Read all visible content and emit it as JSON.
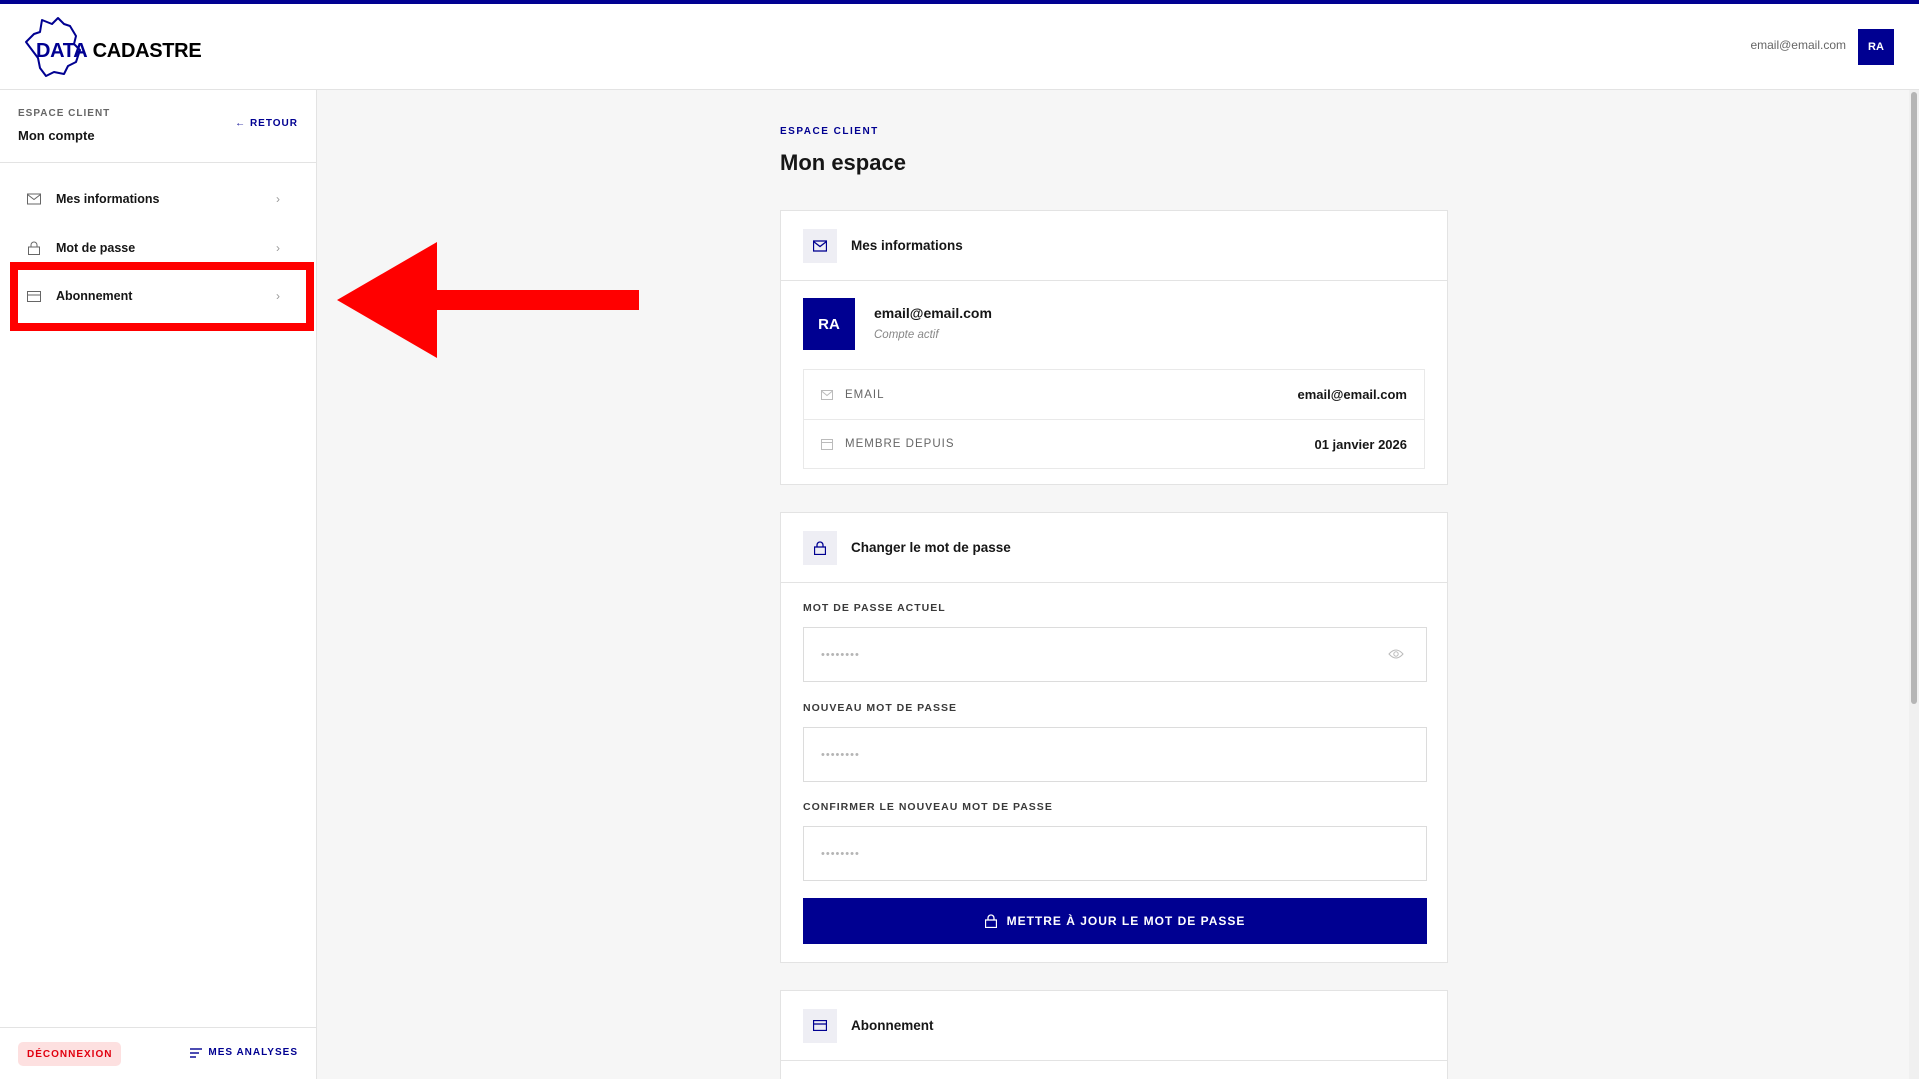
{
  "brand": {
    "logo_text_a": "DATA",
    "logo_text_b": "CADASTRE"
  },
  "header": {
    "user_email": "email@email.com",
    "avatar_initials": "RA"
  },
  "sidebar": {
    "eyebrow": "ESPACE CLIENT",
    "title": "Mon compte",
    "back_label": "← RETOUR",
    "items": [
      {
        "label": "Mes informations",
        "icon": "mail-icon"
      },
      {
        "label": "Mot de passe",
        "icon": "lock-icon"
      },
      {
        "label": "Abonnement",
        "icon": "card-icon"
      }
    ],
    "logout_label": "DÉCONNEXION",
    "analyses_label": "MES ANALYSES"
  },
  "main": {
    "eyebrow": "ESPACE CLIENT",
    "title": "Mon espace",
    "info_card": {
      "title": "Mes informations",
      "avatar_initials": "RA",
      "email": "email@email.com",
      "status": "Compte actif",
      "rows": [
        {
          "key": "EMAIL",
          "value": "email@email.com"
        },
        {
          "key": "MEMBRE DEPUIS",
          "value": "01 janvier 2026"
        }
      ]
    },
    "password_card": {
      "title": "Changer le mot de passe",
      "current_label": "MOT DE PASSE ACTUEL",
      "current_placeholder": "••••••••",
      "new_label": "NOUVEAU MOT DE PASSE",
      "new_placeholder": "••••••••",
      "confirm_label": "CONFIRMER LE NOUVEAU MOT DE PASSE",
      "confirm_placeholder": "••••••••",
      "submit_label": "METTRE À JOUR LE MOT DE PASSE"
    },
    "subscription_card": {
      "title": "Abonnement"
    }
  },
  "colors": {
    "primary": "#000091",
    "highlight": "#ff0000",
    "logout_bg": "#fde0e0",
    "logout_text": "#e1000f"
  }
}
